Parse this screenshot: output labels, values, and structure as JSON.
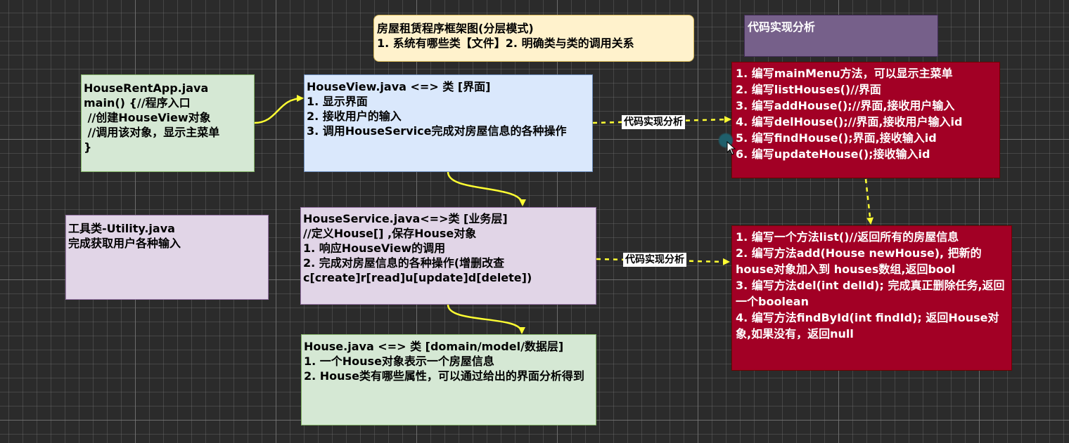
{
  "title_box": {
    "lines": [
      "房屋租赁程序框架图(分层模式)",
      "1. 系统有哪些类【文件】2. 明确类与类的调用关系"
    ]
  },
  "analysis_header": {
    "text": "代码实现分析"
  },
  "app_box": {
    "lines": [
      "HouseRentApp.java",
      "main() {//程序入口",
      " //创建HouseView对象",
      " //调用该对象，显示主菜单",
      "}"
    ]
  },
  "view_box": {
    "lines": [
      "HouseView.java <=> 类 [界面]",
      "1. 显示界面",
      "2. 接收用户的输入",
      "3. 调用HouseService完成对房屋信息的各种操作"
    ]
  },
  "view_impl_box": {
    "lines": [
      "1. 编写mainMenu方法，可以显示主菜单",
      "2. 编写listHouses()//界面",
      "3. 编写addHouse();//界面,接收用户输入",
      "4. 编写delHouse();//界面,接收用户输入id",
      "5. 编写findHouse();界面,接收输入id",
      "6. 编写updateHouse();接收输入id"
    ]
  },
  "utility_box": {
    "lines": [
      "工具类-Utility.java",
      "完成获取用户各种输入"
    ]
  },
  "service_box": {
    "lines": [
      "HouseService.java<=>类 [业务层]",
      "//定义House[] ,保存House对象",
      "1. 响应HouseView的调用",
      "2. 完成对房屋信息的各种操作(增删改查c[create]r[read]u[update]d[delete])"
    ]
  },
  "service_impl_box": {
    "lines": [
      "1. 编写一个方法list()//返回所有的房屋信息",
      "2. 编写方法add(House newHouse), 把新的house对象加入到 houses数组,返回bool",
      "3. 编写方法del(int delId); 完成真正删除任务,返回一个boolean",
      "4. 编写方法findById(int findId); 返回House对象,如果没有，返回null"
    ]
  },
  "house_box": {
    "lines": [
      "House.java <=> 类 [domain/model/数据层]",
      "1. 一个House对象表示一个房屋信息",
      "2. House类有哪些属性，可以通过给出的界面分析得到"
    ]
  },
  "edge_labels": {
    "view_to_impl": "代码实现分析",
    "service_to_impl": "代码实现分析"
  },
  "colors": {
    "arrow_solid": "#ffff33",
    "arrow_dashed": "#ffff33",
    "implementation_box": "#a20025",
    "header_box": "#76608a"
  }
}
